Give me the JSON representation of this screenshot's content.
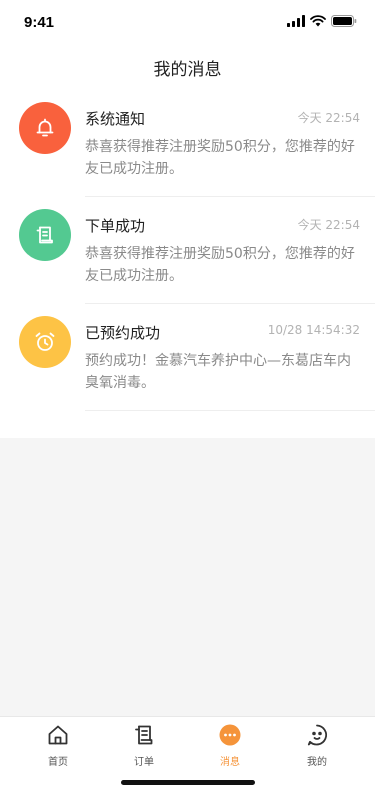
{
  "status_bar": {
    "time": "9:41"
  },
  "header": {
    "title": "我的消息"
  },
  "messages": [
    {
      "title": "系统通知",
      "time": "今天 22:54",
      "body": "恭喜获得推荐注册奖励50积分，您推荐的好友已成功注册。",
      "icon": "bell-icon",
      "color": "#f9613d"
    },
    {
      "title": "下单成功",
      "time": "今天 22:54",
      "body": "恭喜获得推荐注册奖励50积分，您推荐的好友已成功注册。",
      "icon": "receipt-icon",
      "color": "#53c991"
    },
    {
      "title": "已预约成功",
      "time": "10/28 14:54:32",
      "body": "预约成功！金慕汽车养护中心—东葛店车内臭氧消毒。",
      "icon": "alarm-clock-icon",
      "color": "#fdc345"
    }
  ],
  "tab_bar": {
    "active_color": "#f5943a",
    "tabs": [
      {
        "label": "首页",
        "icon": "home-icon"
      },
      {
        "label": "订单",
        "icon": "order-icon"
      },
      {
        "label": "消息",
        "icon": "message-icon",
        "active": true
      },
      {
        "label": "我的",
        "icon": "profile-icon"
      }
    ]
  }
}
